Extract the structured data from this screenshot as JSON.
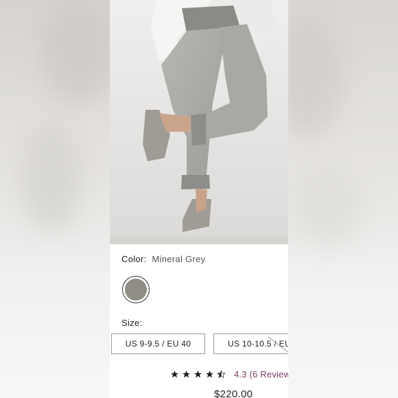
{
  "product": {
    "color_label": "Color:",
    "color_value": "Mineral Grey",
    "swatch_color": "#8f8d84",
    "size_label": "Size:",
    "sizes": [
      "US 9-9.5 / EU 40",
      "US 10-10.5 / EU"
    ],
    "rating_text": "4.3 (6 Review",
    "rating_value": 4.3,
    "price": "$220.00",
    "accent_color": "#7b3a63"
  },
  "icons": {
    "star": "star-icon",
    "half_star": "half-star-icon"
  }
}
